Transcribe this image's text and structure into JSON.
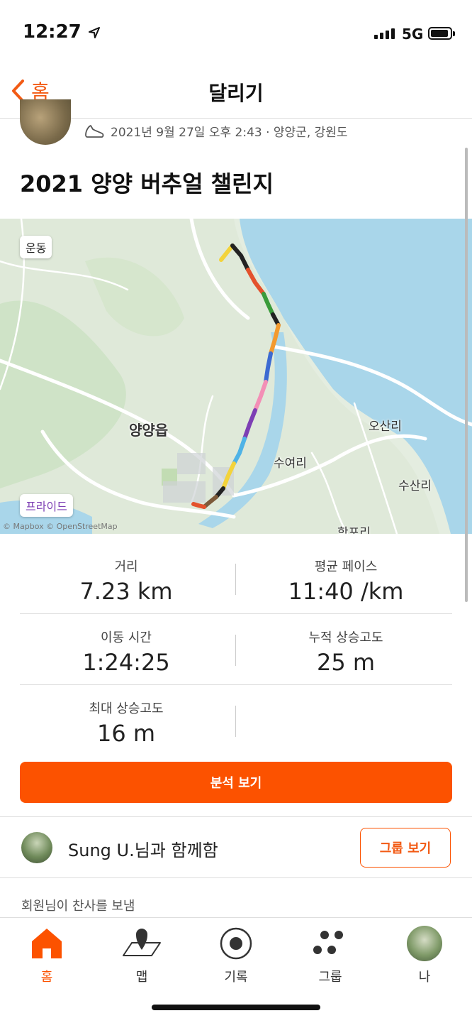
{
  "status_bar": {
    "time": "12:27",
    "network": "5G"
  },
  "nav": {
    "back_label": "홈",
    "title": "달리기"
  },
  "activity": {
    "meta": "2021년 9월 27일 오후 2:43 · 양양군, 강원도",
    "title": "2021 양양 버추얼 챌린지"
  },
  "map": {
    "chip_top": "운동",
    "chip_bottom": "프라이드",
    "places": [
      "양양읍",
      "오산리",
      "수여리",
      "수산리",
      "학포리"
    ],
    "attribution": "© Mapbox © OpenStreetMap",
    "colors": {
      "sea": "#a9d6ea",
      "land": "#e4ede0",
      "park": "#cfe3c7"
    }
  },
  "stats": [
    {
      "label": "거리",
      "value": "7.23 km"
    },
    {
      "label": "평균 페이스",
      "value": "11:40 /km"
    },
    {
      "label": "이동 시간",
      "value": "1:24:25"
    },
    {
      "label": "누적 상승고도",
      "value": "25 m"
    },
    {
      "label": "최대 상승고도",
      "value": "16 m"
    }
  ],
  "analysis_button": "분석 보기",
  "with": {
    "text": "Sung U.님과 함께함",
    "group_button": "그룹 보기"
  },
  "kudos_text": "회원님이 찬사를 보냄",
  "tabs": [
    {
      "label": "홈",
      "icon": "home-icon"
    },
    {
      "label": "맵",
      "icon": "map-icon"
    },
    {
      "label": "기록",
      "icon": "record-icon"
    },
    {
      "label": "그룹",
      "icon": "groups-icon"
    },
    {
      "label": "나",
      "icon": "profile-avatar"
    }
  ],
  "accent_color": "#fc5200"
}
